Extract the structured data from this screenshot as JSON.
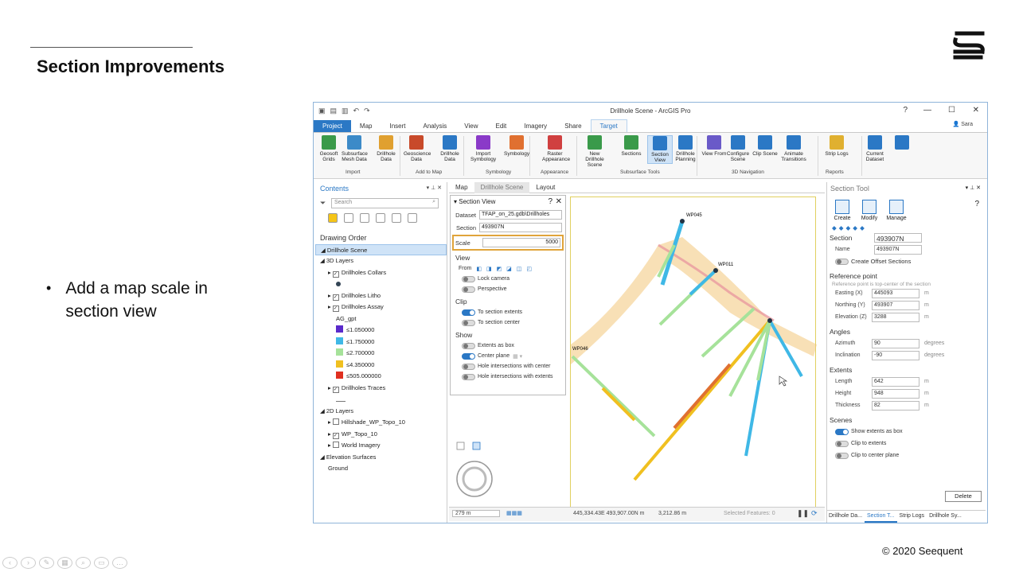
{
  "slide": {
    "title": "Section Improvements",
    "bullet": "Add a map scale in section view",
    "copyright": "© 2020 Seequent"
  },
  "app": {
    "window_title": "Drillhole Scene - ArcGIS Pro",
    "help": "?",
    "user": "Sara",
    "tabs": [
      "Project",
      "Map",
      "Insert",
      "Analysis",
      "View",
      "Edit",
      "Imagery",
      "Share",
      "Target"
    ],
    "active_tab": "Target",
    "ribbon": {
      "buttons": [
        {
          "label": "Geosoft Grids",
          "color": "#3a9a4a"
        },
        {
          "label": "Subsurface Mesh Data",
          "color": "#3c8ac8"
        },
        {
          "label": "Drillhole Data",
          "color": "#e0a030"
        },
        {
          "label": "Geoscience Data",
          "color": "#c84a2a"
        },
        {
          "label": "Drillhole Data",
          "color": "#2b78c5"
        },
        {
          "label": "Import Symbology",
          "color": "#8a3ac8"
        },
        {
          "label": "Symbology",
          "color": "#e07030"
        },
        {
          "label": "Raster Appearance",
          "color": "#d04040"
        },
        {
          "label": "New Drillhole Scene",
          "color": "#3a9a4a"
        },
        {
          "label": "Sections",
          "color": "#3a9a4a"
        },
        {
          "label": "Section View",
          "color": "#2b78c5"
        },
        {
          "label": "Drillhole Planning",
          "color": "#2b78c5"
        },
        {
          "label": "View From",
          "color": "#6a5ac8"
        },
        {
          "label": "Configure Scene",
          "color": "#2b78c5"
        },
        {
          "label": "Clip Scene",
          "color": "#2b78c5"
        },
        {
          "label": "Animate Transitions",
          "color": "#2b78c5"
        },
        {
          "label": "Strip Logs",
          "color": "#e0b030"
        },
        {
          "label": "Current Dataset",
          "color": "#2b78c5"
        },
        {
          "label": "",
          "color": "#2b78c5"
        }
      ],
      "groups": [
        "Import",
        "Add to Map",
        "Symbology",
        "Appearance",
        "Subsurface Tools",
        "3D Navigation",
        "Reports"
      ]
    },
    "contents": {
      "title": "Contents",
      "search_placeholder": "Search",
      "drawing_order": "Drawing Order",
      "items": [
        {
          "label": "Drillhole Scene",
          "level": 0,
          "type": "scene"
        },
        {
          "label": "3D Layers",
          "level": 0,
          "type": "group"
        },
        {
          "label": "Drillholes Collars",
          "level": 1,
          "type": "layer"
        },
        {
          "label": "",
          "level": 2,
          "type": "dot"
        },
        {
          "label": "Drillholes Litho",
          "level": 1,
          "type": "layer"
        },
        {
          "label": "Drillholes Assay",
          "level": 1,
          "type": "layer"
        },
        {
          "label": "AG_gpt",
          "level": 2,
          "type": "text"
        },
        {
          "label": "≤1.050000",
          "level": 2,
          "type": "swatch",
          "color": "#5a2acb"
        },
        {
          "label": "≤1.750000",
          "level": 2,
          "type": "swatch",
          "color": "#3fb8e6"
        },
        {
          "label": "≤2.700000",
          "level": 2,
          "type": "swatch",
          "color": "#a6e29a"
        },
        {
          "label": "≤4.350000",
          "level": 2,
          "type": "swatch",
          "color": "#f0c020"
        },
        {
          "label": "≤505.000000",
          "level": 2,
          "type": "swatch",
          "color": "#e03020"
        },
        {
          "label": "Drillholes Traces",
          "level": 1,
          "type": "layer"
        },
        {
          "label": "",
          "level": 2,
          "type": "line"
        },
        {
          "label": "2D Layers",
          "level": 0,
          "type": "group"
        },
        {
          "label": "Hillshade_WP_Topo_10",
          "level": 1,
          "type": "layer-nocheck"
        },
        {
          "label": "WP_Topo_10",
          "level": 1,
          "type": "layer"
        },
        {
          "label": "World Imagery",
          "level": 1,
          "type": "layer-nocheck"
        },
        {
          "label": "Elevation Surfaces",
          "level": 0,
          "type": "group"
        },
        {
          "label": "Ground",
          "level": 1,
          "type": "plain"
        }
      ]
    },
    "view_tabs": [
      "Map",
      "Drillhole Scene",
      "Layout"
    ],
    "section_view": {
      "title": "Section View",
      "dataset_label": "Dataset",
      "dataset_value": "TFAP_on_25.gdb\\Drillholes",
      "section_label": "Section",
      "section_value": "493907N",
      "scale_label": "Scale",
      "scale_value": "5000",
      "view_label": "View",
      "from_label": "From",
      "lock_camera": "Lock camera",
      "perspective": "Perspective",
      "clip_label": "Clip",
      "to_section_extents": "To section extents",
      "to_section_center": "To section center",
      "show_label": "Show",
      "extents_as_box": "Extents as box",
      "center_plane": "Center plane",
      "hole_int_center": "Hole intersections with center",
      "hole_int_extents": "Hole intersections with extents"
    },
    "map": {
      "labels": [
        "WP045",
        "WP011",
        "WP046"
      ]
    },
    "status": {
      "scale": "279 m",
      "coords": "445,334.43E 493,907.00N m",
      "elev": "3,212.86 m",
      "selected": "Selected Features: 0"
    },
    "section_tool": {
      "title": "Section Tool",
      "help": "?",
      "create": "Create",
      "modify": "Modify",
      "manage": "Manage",
      "section_label": "Section",
      "section_value": "493907N",
      "name_label": "Name",
      "name_value": "493907N",
      "create_offset": "Create Offset Sections",
      "ref_point": "Reference point",
      "ref_hint": "Reference point is top-center of the section",
      "easting_label": "Easting (X)",
      "easting": "445093",
      "northing_label": "Northing (Y)",
      "northing": "493907",
      "elevation_label": "Elevation (Z)",
      "elevation": "3288",
      "angles": "Angles",
      "azimuth_label": "Azimuth",
      "azimuth": "90",
      "inclination_label": "Inclination",
      "inclination": "-90",
      "extents": "Extents",
      "length_label": "Length",
      "length": "642",
      "height_label": "Height",
      "height": "948",
      "thickness_label": "Thickness",
      "thickness": "82",
      "scenes": "Scenes",
      "show_extents_box": "Show extents as box",
      "clip_extents": "Clip to extents",
      "clip_center": "Clip to center plane",
      "delete": "Delete",
      "unit_m": "m",
      "unit_deg": "degrees"
    },
    "bottom_tabs": [
      "Drillhole Da...",
      "Section T...",
      "Strip Logs",
      "Drillhole Sy..."
    ]
  }
}
